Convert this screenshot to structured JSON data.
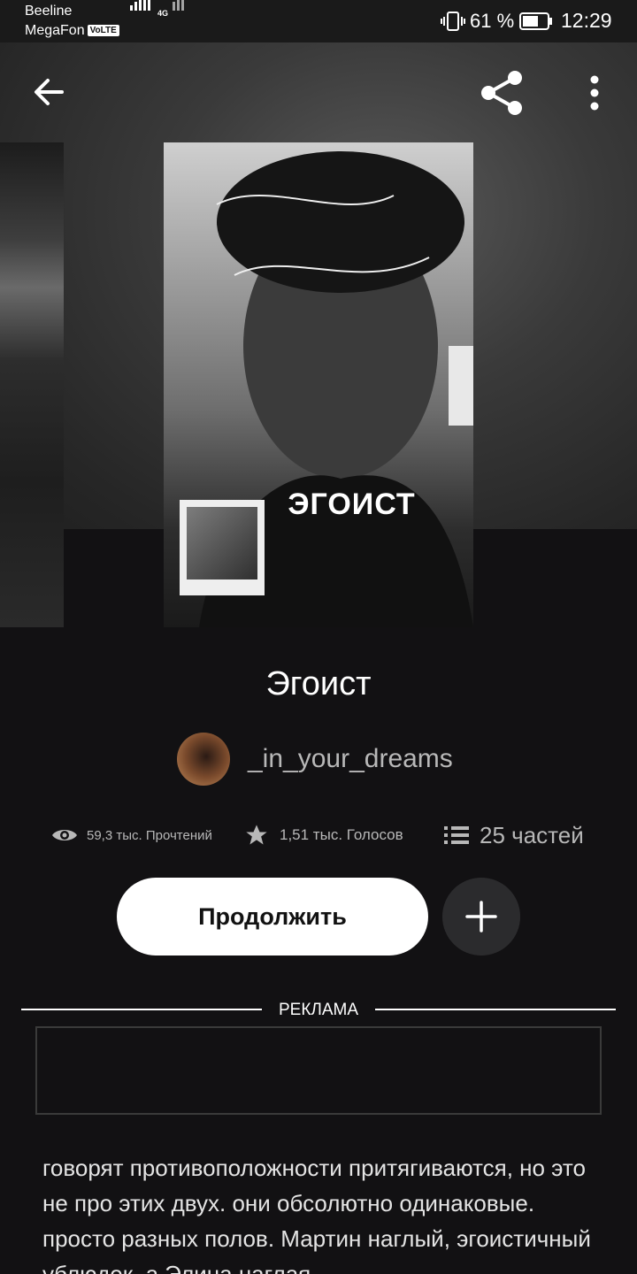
{
  "status_bar": {
    "carrier_1": "Beeline",
    "carrier_2": "MegaFon",
    "volte": "VoLTE",
    "network": "4G",
    "battery_percent": "61 %",
    "time": "12:29"
  },
  "toolbar": {
    "back_icon": "arrow-left-icon",
    "share_icon": "share-icon",
    "more_icon": "more-vertical-icon"
  },
  "cover": {
    "title_text": "ЭГОИСТ"
  },
  "story": {
    "title": "Эгоист",
    "author": "_in_your_dreams"
  },
  "stats": {
    "reads": "59,3 тыс. Прочтений",
    "votes": "1,51 тыс. Голосов",
    "parts": "25 частей"
  },
  "actions": {
    "continue_label": "Продолжить",
    "add_icon": "plus-icon"
  },
  "ad": {
    "label": "РЕКЛАМА"
  },
  "description": {
    "text": "говорят противоположности притягиваются, но это не про этих двух. они обсолютно одинаковые. просто разных полов. Мартин наглый, эгоистичный ублюдок, а Элина наглая"
  },
  "colors": {
    "background": "#121113",
    "button_primary": "#ffffff",
    "button_secondary": "#2b2b2d",
    "muted_text": "#b8b8b8"
  }
}
